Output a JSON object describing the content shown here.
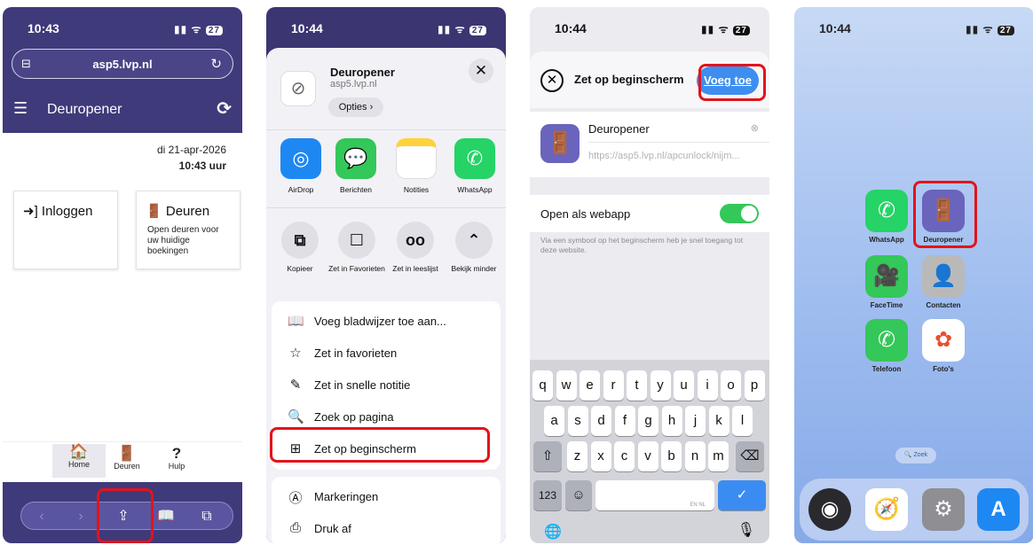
{
  "colors": {
    "app_purple": "#3f3a7a",
    "highlight_red": "#e3131b",
    "ios_blue": "#3d8ef0",
    "ios_green": "#34c759"
  },
  "phone1": {
    "status": {
      "time": "10:43",
      "bell": "🔕",
      "signal": "▮▮ ᯤ",
      "battery": "27"
    },
    "url": "asp5.lvp.nl",
    "app_title": "Deuropener",
    "date": "di 21-apr-2026",
    "time_display": "10:43 uur",
    "cards": [
      {
        "title": "Inloggen",
        "desc": ""
      },
      {
        "title": "Deuren",
        "desc": "Open deuren voor uw huidige boekingen"
      }
    ],
    "tabs": [
      {
        "icon": "🏠",
        "label": "Home"
      },
      {
        "icon": "🚪",
        "label": "Deuren"
      },
      {
        "icon": "?",
        "label": "Hulp"
      }
    ]
  },
  "phone2": {
    "status": {
      "time": "10:44",
      "bell": "🔕",
      "signal": "▮▮ ᯤ",
      "battery": "27"
    },
    "site_title": "Deuropener",
    "site_url": "asp5.lvp.nl",
    "opties_label": "Opties ›",
    "apps": [
      {
        "label": "AirDrop",
        "color": "#1e88f2",
        "icon": "◎"
      },
      {
        "label": "Berichten",
        "color": "#34c759",
        "icon": "💬"
      },
      {
        "label": "Notities",
        "color": "#ffffff",
        "icon": ""
      },
      {
        "label": "WhatsApp",
        "color": "#25d366",
        "icon": "✆"
      }
    ],
    "actions": [
      {
        "label": "Kopieer",
        "icon": "⧉"
      },
      {
        "label": "Zet in Favorieten",
        "icon": "☐"
      },
      {
        "label": "Zet in leeslijst",
        "icon": "oo"
      },
      {
        "label": "Bekijk minder",
        "icon": "⌃"
      }
    ],
    "menu1": [
      {
        "label": "Voeg bladwijzer toe aan...",
        "icon": "📖"
      },
      {
        "label": "Zet in favorieten",
        "icon": "☆"
      },
      {
        "label": "Zet in snelle notitie",
        "icon": "✎"
      },
      {
        "label": "Zoek op pagina",
        "icon": "🔍"
      },
      {
        "label": "Zet op beginscherm",
        "icon": "⊞"
      }
    ],
    "menu2": [
      {
        "label": "Markeringen",
        "icon": "Ⓐ"
      },
      {
        "label": "Druk af",
        "icon": "⎙"
      }
    ]
  },
  "phone3": {
    "status": {
      "time": "10:44",
      "bell": "🔕",
      "signal": "▮▮ ᯤ",
      "battery": "27"
    },
    "title": "Zet op beginscherm",
    "add_label": "Voeg toe",
    "app_name": "Deuropener",
    "app_url": "https://asp5.lvp.nl/apcunlock/nijm...",
    "webapp_label": "Open als webapp",
    "note": "Via een symbool op het beginscherm heb je snel toegang tot deze website.",
    "keyboard": {
      "row1": [
        "q",
        "w",
        "e",
        "r",
        "t",
        "y",
        "u",
        "i",
        "o",
        "p"
      ],
      "row2": [
        "a",
        "s",
        "d",
        "f",
        "g",
        "h",
        "j",
        "k",
        "l"
      ],
      "row3": [
        "z",
        "x",
        "c",
        "v",
        "b",
        "n",
        "m"
      ],
      "shift": "⇧",
      "backspace": "⌫",
      "numbers": "123",
      "emoji": "☺",
      "space_hint": "EN NL",
      "return": "✓",
      "globe": "🌐",
      "mic": "🎙"
    }
  },
  "phone4": {
    "status": {
      "time": "10:44",
      "bell": "🔕",
      "signal": "▮▮ ᯤ",
      "battery": "27"
    },
    "icons": [
      {
        "label": "WhatsApp",
        "color": "#25d366",
        "icon": "✆"
      },
      {
        "label": "Deuropener",
        "color": "#6a64bd",
        "icon": "🚪"
      },
      {
        "label": "FaceTime",
        "color": "#34c759",
        "icon": "🎥"
      },
      {
        "label": "Contacten",
        "color": "#b9b9b9",
        "icon": "👤"
      },
      {
        "label": "Telefoon",
        "color": "#34c759",
        "icon": "✆"
      },
      {
        "label": "Foto's",
        "color": "#ffffff",
        "icon": "✿"
      }
    ],
    "search_label": "🔍 Zoek",
    "dock": [
      {
        "name": "Camera",
        "color": "#2a2a2e",
        "icon": "◉"
      },
      {
        "name": "Safari",
        "color": "#ffffff",
        "icon": "🧭"
      },
      {
        "name": "Instellingen",
        "color": "#8e8e93",
        "icon": "⚙"
      },
      {
        "name": "App Store",
        "color": "#1e88f2",
        "icon": "A"
      }
    ]
  }
}
